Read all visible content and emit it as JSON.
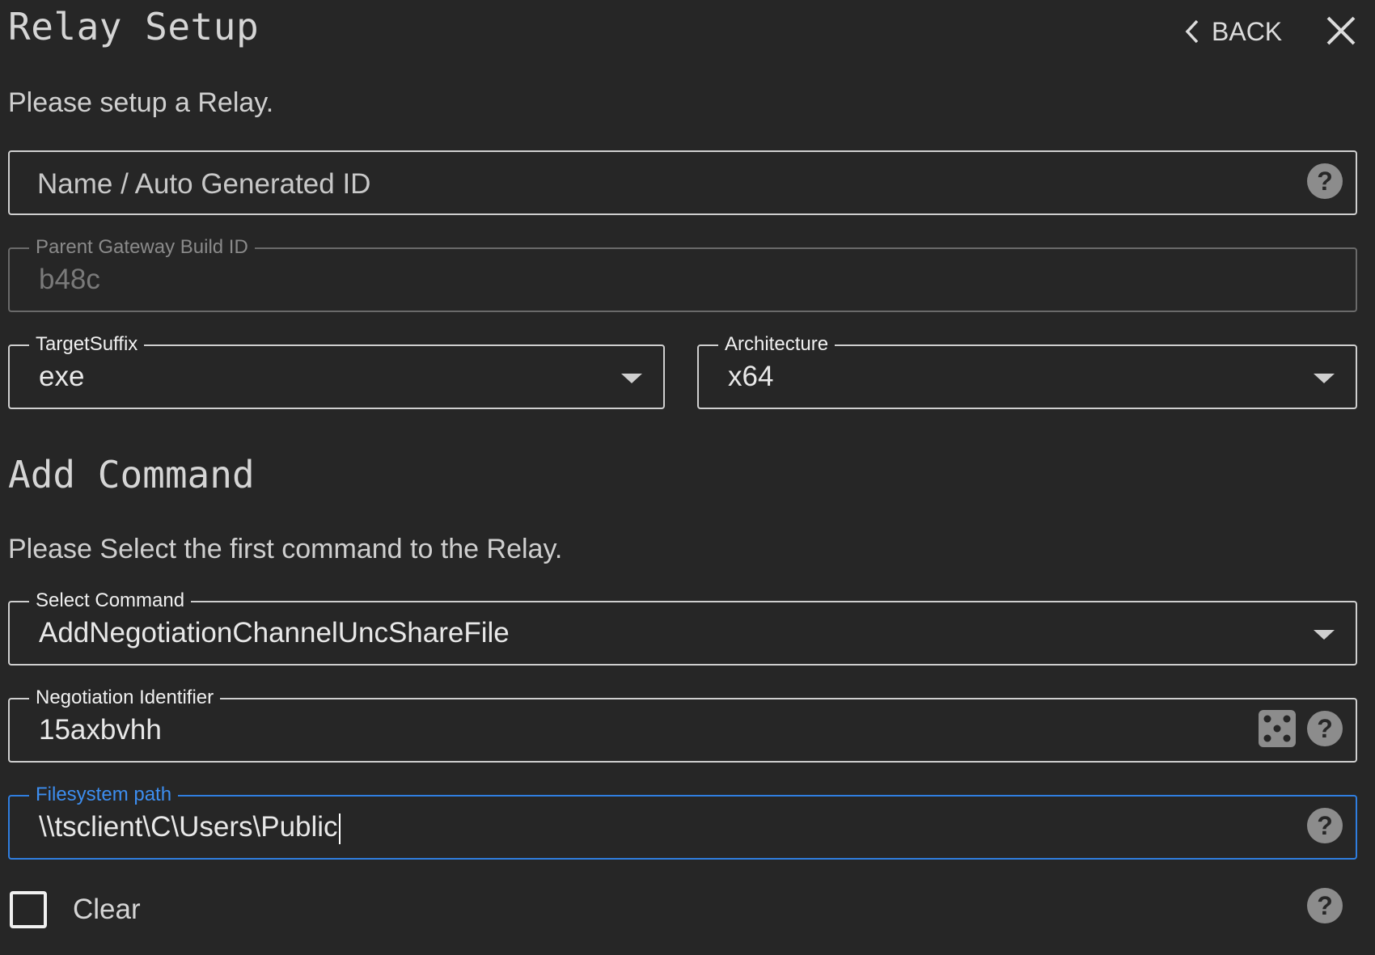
{
  "header": {
    "title": "Relay Setup",
    "back_label": "BACK"
  },
  "relay": {
    "intro": "Please setup a Relay.",
    "name_placeholder": "Name / Auto Generated ID",
    "parent_gateway": {
      "label": "Parent Gateway Build ID",
      "value": "b48c"
    },
    "target_suffix": {
      "label": "TargetSuffix",
      "value": "exe"
    },
    "architecture": {
      "label": "Architecture",
      "value": "x64"
    }
  },
  "command": {
    "section_title": "Add Command",
    "intro": "Please Select the first command to the Relay.",
    "select_command": {
      "label": "Select Command",
      "value": "AddNegotiationChannelUncShareFile"
    },
    "negotiation_identifier": {
      "label": "Negotiation Identifier",
      "value": "15axbvhh"
    },
    "filesystem_path": {
      "label": "Filesystem path",
      "value": "\\\\tsclient\\C\\Users\\Public"
    },
    "clear": {
      "label": "Clear",
      "checked": false
    }
  },
  "colors": {
    "background": "#262626",
    "accent": "#2f7ee0",
    "border": "#cfcfcf",
    "help_icon": "#8c8c8c"
  },
  "icons": [
    "chevron-left-icon",
    "close-icon",
    "help-icon",
    "dice-icon",
    "dropdown-arrow-icon"
  ]
}
